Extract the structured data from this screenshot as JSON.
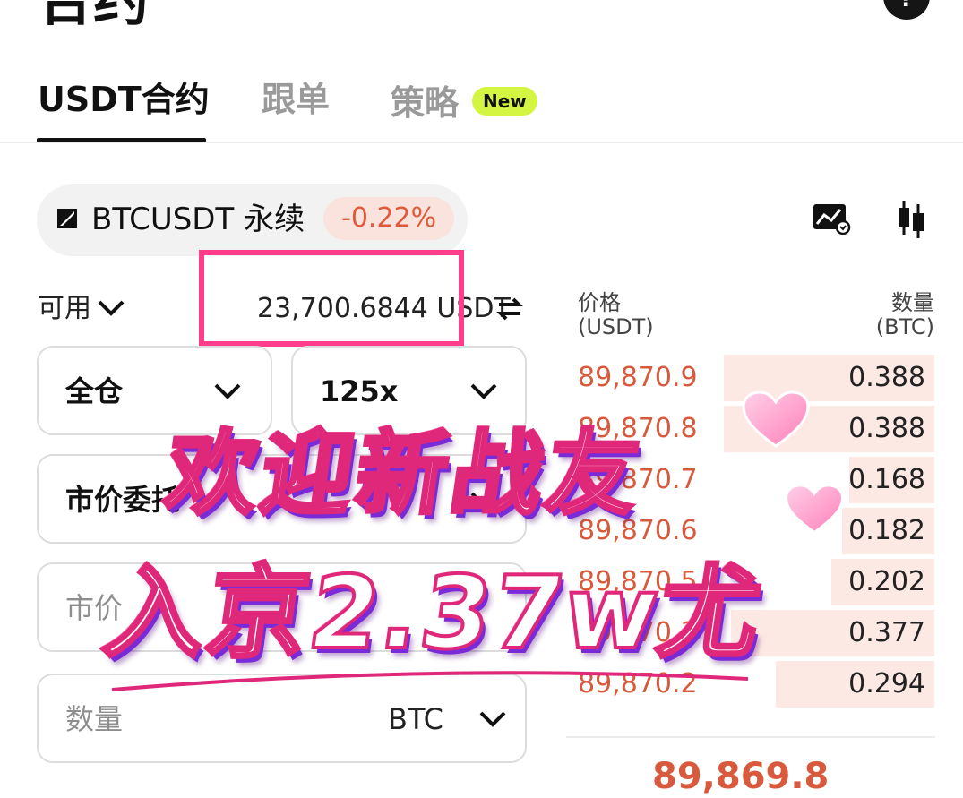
{
  "header": {
    "title": "合约",
    "help_symbol": "?"
  },
  "tabs": [
    {
      "label": "USDT合约",
      "active": true
    },
    {
      "label": "跟单",
      "active": false
    },
    {
      "label": "策略",
      "active": false,
      "badge": "New"
    }
  ],
  "symbol": {
    "name": "BTCUSDT 永续",
    "change": "-0.22%",
    "icon": "square-triangle-icon"
  },
  "toolbar_icons": [
    "chart-icon",
    "candlestick-icon"
  ],
  "available": {
    "label": "可用",
    "amount": "23,700.6844 USDT"
  },
  "form": {
    "margin_mode": "全仓",
    "leverage": "125x",
    "order_type": "市价委托",
    "price_placeholder": "市价",
    "quantity_placeholder": "数量",
    "quantity_unit": "BTC"
  },
  "orderbook": {
    "price_header_1": "价格",
    "price_header_2": "(USDT)",
    "qty_header_1": "数量",
    "qty_header_2": "(BTC)",
    "asks": [
      {
        "price": "89,870.9",
        "qty": "0.388",
        "depth": 0.57
      },
      {
        "price": "89,870.8",
        "qty": "0.388",
        "depth": 0.57
      },
      {
        "price": "89,870.7",
        "qty": "0.168",
        "depth": 0.23
      },
      {
        "price": "89,870.6",
        "qty": "0.182",
        "depth": 0.25
      },
      {
        "price": "89,870.5",
        "qty": "0.202",
        "depth": 0.28
      },
      {
        "price": "89,870.3",
        "qty": "0.377",
        "depth": 0.55
      },
      {
        "price": "89,870.2",
        "qty": "0.294",
        "depth": 0.43
      }
    ],
    "last_price": "89,869.8"
  },
  "overlay": {
    "line1": "欢迎新战友",
    "line2": "入京2.37w尤"
  },
  "colors": {
    "accent_red": "#d8593c",
    "badge_green": "#d4f542",
    "highlight_pink": "#ff3d8b"
  }
}
